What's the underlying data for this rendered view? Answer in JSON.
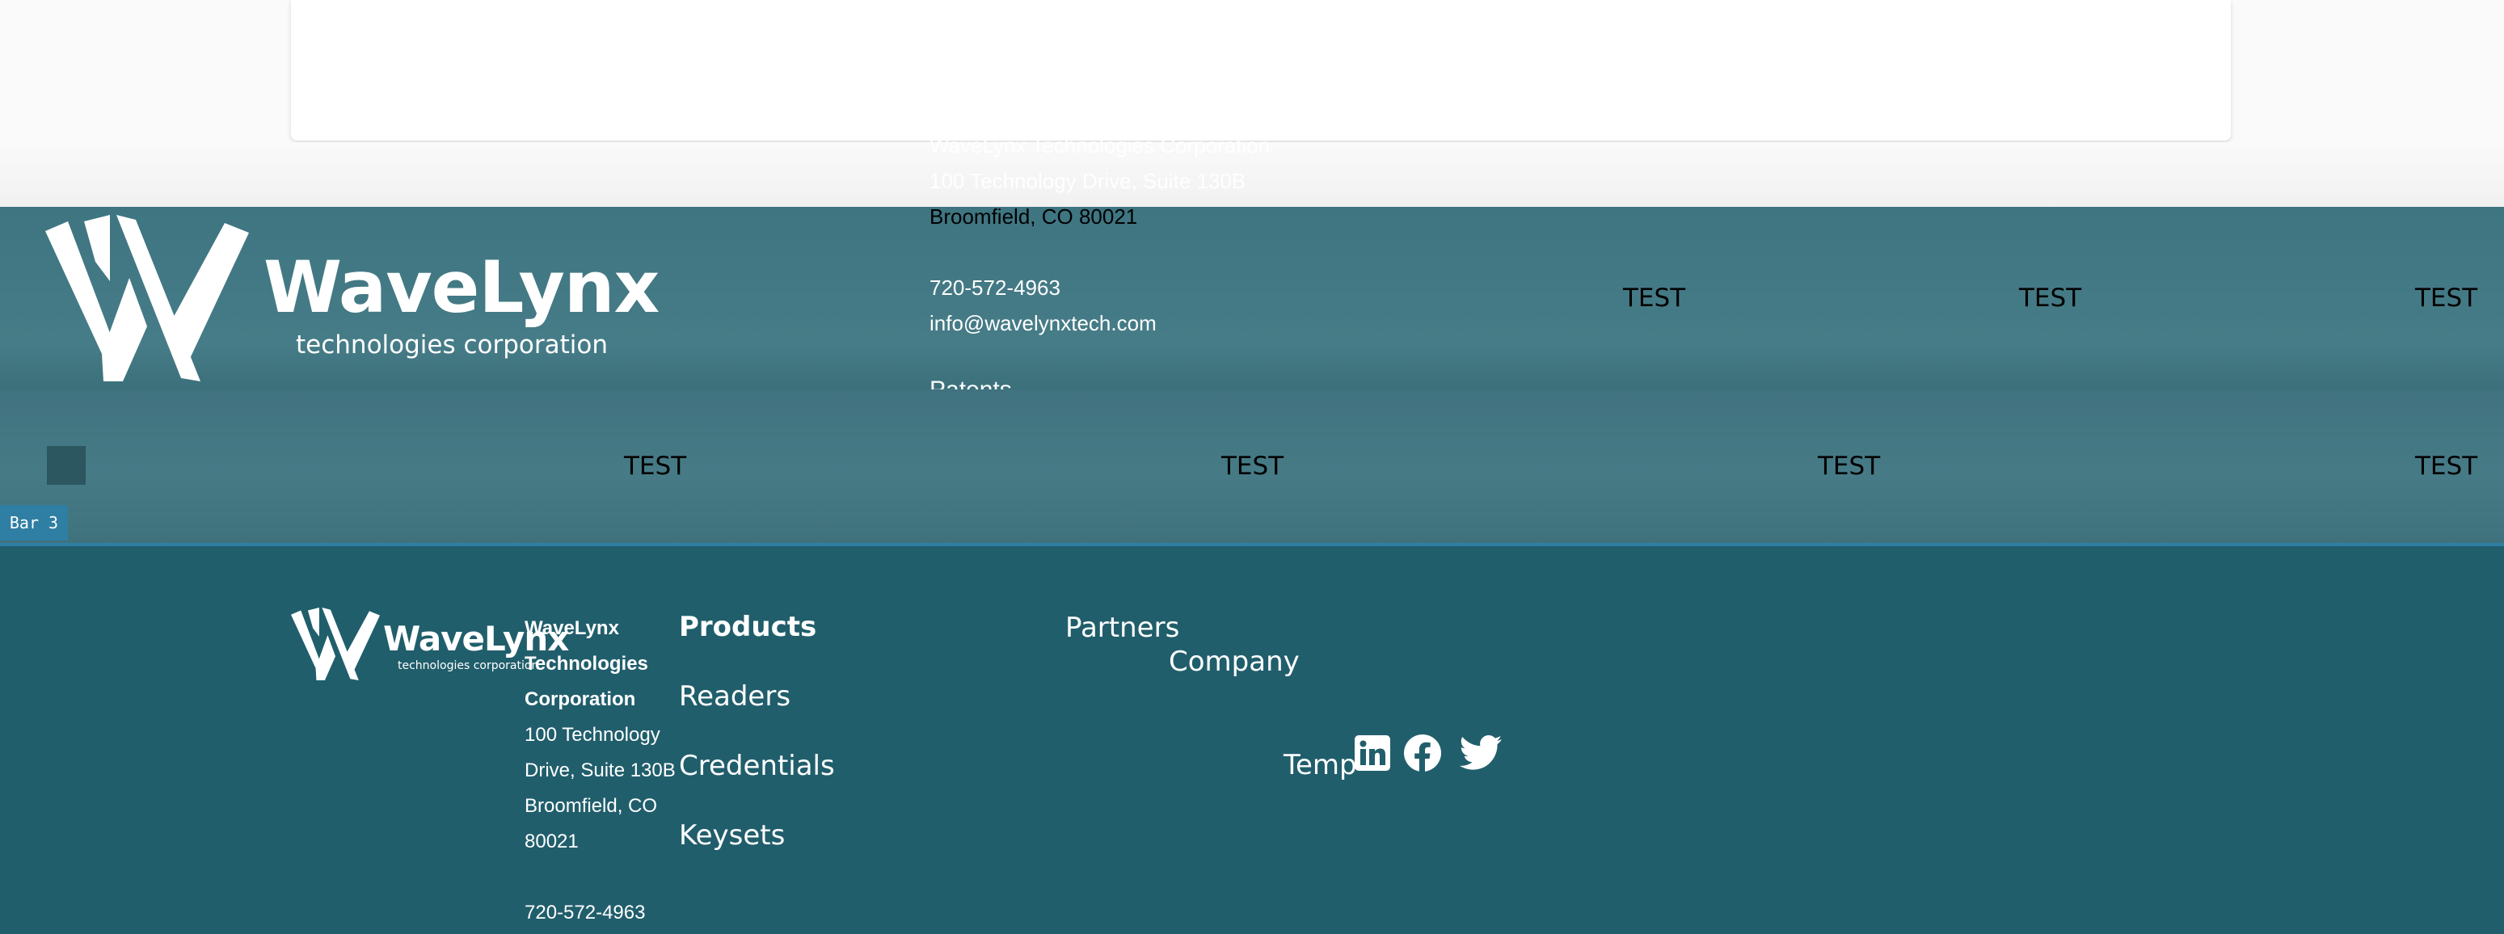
{
  "overflow_contact": {
    "company": "WaveLynx Technologies Corporation",
    "street": "100 Technology Drive, Suite 130B",
    "city": "Broomfield, CO 80021",
    "phone": "720-572-4963",
    "email": "info@wavelynxtech.com",
    "patents": "Patents"
  },
  "brand": {
    "name": "WaveLynx",
    "tagline": "technologies corporation"
  },
  "bar1": {
    "tests": [
      "TEST",
      "TEST",
      "TEST"
    ]
  },
  "bar2": {
    "tests": [
      "TEST",
      "TEST",
      "TEST",
      "TEST"
    ]
  },
  "bar_label": "Bar 3",
  "footer": {
    "address": {
      "company_lines": [
        "WaveLynx",
        "Technologies",
        "Corporation"
      ],
      "street_lines": [
        "100 Technology",
        "Drive, Suite 130B"
      ],
      "city_lines": [
        "Broomfield, CO",
        "80021"
      ],
      "phone": "720-572-4963"
    },
    "products": {
      "heading": "Products",
      "items": [
        "Readers",
        "Credentials",
        "Keysets"
      ]
    },
    "links": {
      "partners": "Partners",
      "company": "Company",
      "temp": "Temp"
    },
    "social": [
      "linkedin-icon",
      "facebook-icon",
      "twitter-icon"
    ]
  },
  "colors": {
    "bar1": "#427883",
    "bar2": "#43787f",
    "footer_bg": "#215e6c",
    "accent": "#2f7ea3"
  }
}
